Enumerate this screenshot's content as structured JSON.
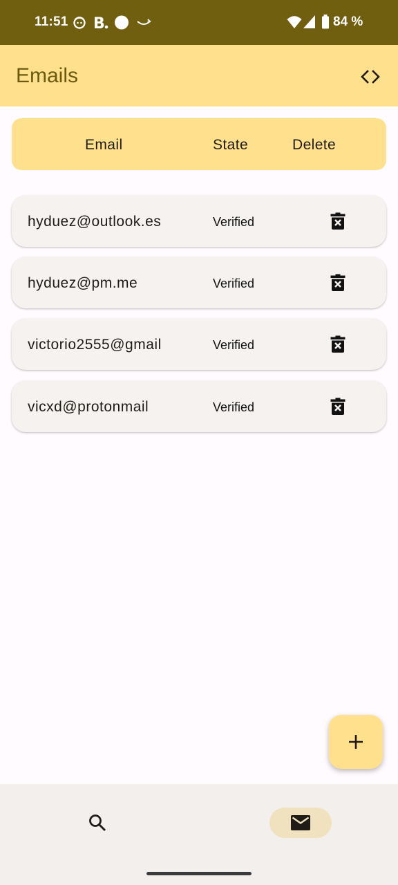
{
  "status_bar": {
    "time": "11:51",
    "battery_percent": "84 %"
  },
  "app_bar": {
    "title": "Emails",
    "code_icon": "code-icon"
  },
  "table_header": {
    "email": "Email",
    "state": "State",
    "delete": "Delete"
  },
  "emails": [
    {
      "email": "hyduez@outlook.es",
      "state": "Verified"
    },
    {
      "email": "hyduez@pm.me",
      "state": "Verified"
    },
    {
      "email": "victorio2555@gmail",
      "state": "Verified"
    },
    {
      "email": "vicxd@protonmail",
      "state": "Verified"
    }
  ],
  "fab": {
    "icon": "plus-icon"
  },
  "bottom_nav": {
    "items": [
      {
        "icon": "search-icon",
        "active": false
      },
      {
        "icon": "mail-icon",
        "active": true
      }
    ]
  },
  "colors": {
    "status_bar": "#715F10",
    "primary_container": "#FFE08D",
    "row_background": "#F5F2EF",
    "nav_background": "#F3EFEC",
    "nav_active_indicator": "#F0E2BF"
  }
}
